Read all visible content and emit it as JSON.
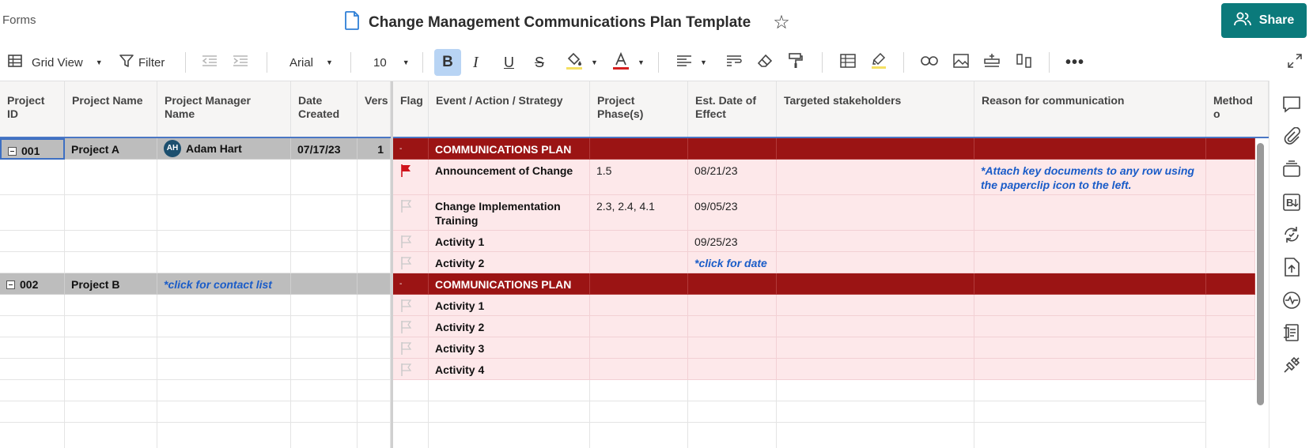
{
  "app": {
    "forms_link": "Forms",
    "title": "Change Management Communications Plan Template",
    "share_label": "Share"
  },
  "toolbar": {
    "view_label": "Grid View",
    "filter_label": "Filter",
    "font_family": "Arial",
    "font_size": "10"
  },
  "columns": [
    "Project ID",
    "Project Name",
    "Project Manager Name",
    "Date Created",
    "Vers",
    "Flag",
    "Event / Action / Strategy",
    "Project Phase(s)",
    "Est. Date of Effect",
    "Targeted stakeholders",
    "Reason for communication",
    "Method o"
  ],
  "rows": [
    {
      "type": "parent",
      "project_id": "001",
      "project_name": "Project A",
      "manager": "Adam Hart",
      "manager_initials": "AH",
      "date_created": "07/17/23",
      "vers": "1",
      "flag": "-",
      "event": "COMMUNICATIONS PLAN"
    },
    {
      "type": "child",
      "flag": "red",
      "event": "Announcement of Change",
      "phase": "1.5",
      "est_date": "08/21/23",
      "reason": "*Attach key documents to any row using the paperclip icon to the left."
    },
    {
      "type": "child",
      "flag": "empty",
      "event": "Change Implementation Training",
      "phase": "2.3, 2.4, 4.1",
      "est_date": "09/05/23"
    },
    {
      "type": "child",
      "flag": "empty",
      "event": "Activity 1",
      "est_date": "09/25/23"
    },
    {
      "type": "child",
      "flag": "empty",
      "event": "Activity 2",
      "est_date_link": "*click for date"
    },
    {
      "type": "parent",
      "project_id": "002",
      "project_name": "Project B",
      "manager_link": "*click for contact list",
      "flag": "-",
      "event": "COMMUNICATIONS PLAN"
    },
    {
      "type": "child",
      "flag": "empty",
      "event": "Activity 1"
    },
    {
      "type": "child",
      "flag": "empty",
      "event": "Activity 2"
    },
    {
      "type": "child",
      "flag": "empty",
      "event": "Activity 3"
    },
    {
      "type": "child",
      "flag": "empty",
      "event": "Activity 4"
    }
  ],
  "colors": {
    "accent": "#0b7a7b",
    "parent_band": "#9b1414",
    "child_band": "#fde8ea",
    "link": "#1a5cc8",
    "flag_red": "#d0121b"
  },
  "rail_icons": [
    "comment-icon",
    "paperclip-icon",
    "proofing-icon",
    "summary-icon",
    "automation-icon",
    "upload-icon",
    "activity-icon",
    "publish-icon",
    "connector-icon"
  ]
}
